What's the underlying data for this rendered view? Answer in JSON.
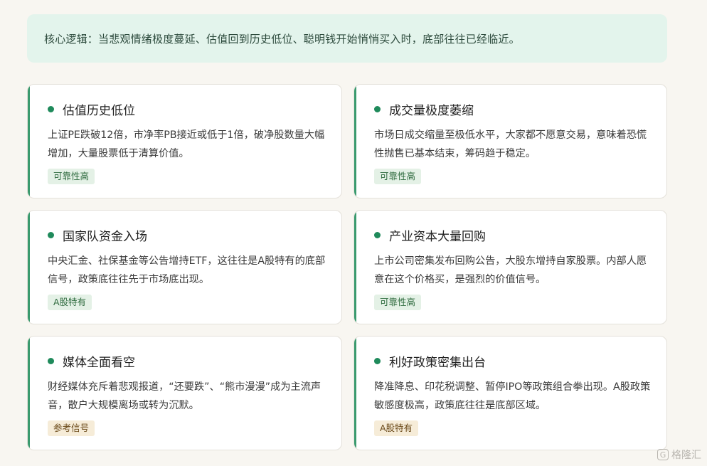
{
  "banner": {
    "text": "核心逻辑：当悲观情绪极度蔓延、估值回到历史低位、聪明钱开始悄悄买入时，底部往往已经临近。"
  },
  "cards": [
    {
      "title": "估值历史低位",
      "desc": "上证PE跌破12倍，市净率PB接近或低于1倍，破净股数量大幅增加，大量股票低于清算价值。",
      "tag": "可靠性高",
      "tag_color": "#e4f1e6"
    },
    {
      "title": "成交量极度萎缩",
      "desc": "市场日成交缩量至极低水平，大家都不愿意交易，意味着恐慌性抛售已基本结束，筹码趋于稳定。",
      "tag": "可靠性高",
      "tag_color": "#e4f1e6"
    },
    {
      "title": "国家队资金入场",
      "desc": "中央汇金、社保基金等公告增持ETF，这往往是A股特有的底部信号，政策底往往先于市场底出现。",
      "tag": "A股特有",
      "tag_color": "#e4f1e6"
    },
    {
      "title": "产业资本大量回购",
      "desc": "上市公司密集发布回购公告，大股东增持自家股票。内部人愿意在这个价格买，是强烈的价值信号。",
      "tag": "可靠性高",
      "tag_color": "#e4f1e6"
    },
    {
      "title": "媒体全面看空",
      "desc": "财经媒体充斥着悲观报道，“还要跌”、“熊市漫漫”成为主流声音，散户大规模离场或转为沉默。",
      "tag": "参考信号",
      "tag_color": "#f6ecd8"
    },
    {
      "title": "利好政策密集出台",
      "desc": "降准降息、印花税调整、暂停IPO等政策组合拳出现。A股政策敏感度极高，政策底往往是底部区域。",
      "tag": "A股特有",
      "tag_color": "#f6ecd8"
    }
  ],
  "colors": {
    "accent_green": "#1f8a5b",
    "border_green": "#3a9a6e",
    "banner_bg": "#e3f4ec"
  },
  "watermark": {
    "icon": "g-logo-icon",
    "text": "格隆汇"
  }
}
